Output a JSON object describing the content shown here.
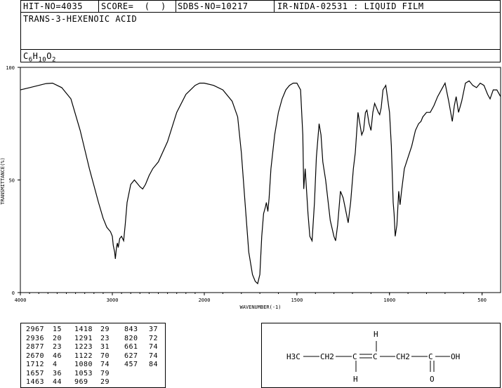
{
  "header": {
    "hit_no": "HIT-NO=4035",
    "score": "SCORE=  (  )",
    "sdbs_no": "SDBS-NO=10217",
    "ir_no": "IR-NIDA-02531 : LIQUID FILM",
    "compound_name": "TRANS-3-HEXENOIC ACID",
    "formula": {
      "c": "C",
      "c_n": "6",
      "h": "H",
      "h_n": "10",
      "o": "O",
      "o_n": "2"
    }
  },
  "chart_data": {
    "type": "line",
    "xlabel": "WAVENUMBER(-1)",
    "ylabel": "TRANSMITTANCE(%)",
    "xlim": [
      4000,
      400
    ],
    "ylim": [
      0,
      100
    ],
    "x_ticks": [
      "4000",
      "3000",
      "2000",
      "1500",
      "1000",
      "500"
    ],
    "y_ticks": [
      "0",
      "50",
      "100"
    ],
    "series": [
      {
        "x": [
          4000,
          3900,
          3800,
          3720,
          3650,
          3550,
          3450,
          3350,
          3250,
          3150,
          3100,
          3060,
          3040,
          3020,
          3000,
          2990,
          2975,
          2967,
          2955,
          2945,
          2936,
          2920,
          2900,
          2877,
          2860,
          2840,
          2800,
          2760,
          2720,
          2700,
          2670,
          2640,
          2600,
          2560,
          2500,
          2400,
          2300,
          2200,
          2100,
          2050,
          2000,
          1950,
          1900,
          1850,
          1820,
          1800,
          1780,
          1760,
          1740,
          1725,
          1712,
          1700,
          1690,
          1680,
          1670,
          1665,
          1657,
          1650,
          1640,
          1620,
          1600,
          1580,
          1560,
          1540,
          1520,
          1500,
          1480,
          1468,
          1463,
          1455,
          1440,
          1430,
          1418,
          1405,
          1395,
          1380,
          1370,
          1360,
          1345,
          1320,
          1300,
          1291,
          1280,
          1265,
          1250,
          1240,
          1223,
          1210,
          1195,
          1185,
          1170,
          1150,
          1140,
          1130,
          1122,
          1110,
          1100,
          1090,
          1080,
          1070,
          1060,
          1053,
          1045,
          1035,
          1020,
          1000,
          990,
          980,
          975,
          969,
          960,
          950,
          943,
          935,
          920,
          900,
          880,
          860,
          843,
          830,
          820,
          800,
          780,
          760,
          740,
          720,
          700,
          680,
          661,
          650,
          640,
          627,
          610,
          590,
          570,
          550,
          530,
          510,
          490,
          470,
          457,
          440,
          420,
          400
        ],
        "y": [
          90,
          91,
          92,
          92.8,
          93,
          91,
          86,
          72,
          55,
          40,
          33,
          29,
          28,
          27,
          25,
          21,
          18,
          15,
          20,
          22,
          20,
          24,
          25,
          23,
          30,
          40,
          48,
          50,
          48,
          47,
          46,
          48,
          52,
          55,
          58,
          67,
          80,
          88,
          92,
          93,
          93,
          92,
          90,
          85,
          78,
          62,
          40,
          18,
          8,
          5,
          4,
          8,
          25,
          35,
          38,
          40,
          36,
          42,
          55,
          70,
          80,
          86,
          90,
          92,
          93,
          93,
          90,
          70,
          46,
          55,
          35,
          25,
          23,
          40,
          60,
          75,
          70,
          58,
          50,
          32,
          25,
          23,
          30,
          45,
          42,
          38,
          31,
          40,
          55,
          62,
          80,
          70,
          72,
          80,
          81,
          75,
          72,
          80,
          84,
          82,
          80,
          79,
          82,
          90,
          92,
          80,
          65,
          40,
          35,
          25,
          30,
          45,
          39,
          45,
          55,
          60,
          65,
          72,
          75,
          76,
          78,
          80,
          80,
          83,
          87,
          90,
          93,
          85,
          76,
          83,
          87,
          80,
          85,
          93,
          94,
          92,
          91,
          93,
          92,
          88,
          86,
          90,
          90,
          87
        ]
      }
    ]
  },
  "peak_table": {
    "col1": [
      [
        "2967",
        "15"
      ],
      [
        "2936",
        "20"
      ],
      [
        "2877",
        "23"
      ],
      [
        "2670",
        "46"
      ],
      [
        "1712",
        "4"
      ],
      [
        "1657",
        "36"
      ],
      [
        "1463",
        "44"
      ]
    ],
    "col2": [
      [
        "1418",
        "29"
      ],
      [
        "1291",
        "23"
      ],
      [
        "1223",
        "31"
      ],
      [
        "1122",
        "70"
      ],
      [
        "1080",
        "74"
      ],
      [
        "1053",
        "79"
      ],
      [
        "969",
        "29"
      ]
    ],
    "col3": [
      [
        "843",
        "37"
      ],
      [
        "820",
        "72"
      ],
      [
        "661",
        "74"
      ],
      [
        "627",
        "74"
      ],
      [
        "457",
        "84"
      ]
    ]
  },
  "structure": {
    "h_top": "H",
    "h_bottom": "H",
    "o_bottom": "O",
    "group1": "H3C",
    "group2": "CH2",
    "group3": "CH2",
    "group4": "OH",
    "c1": "C",
    "c2": "C",
    "c3": "C"
  }
}
